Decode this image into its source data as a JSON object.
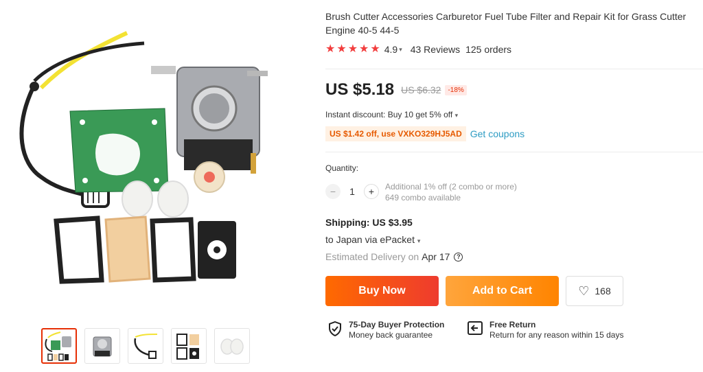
{
  "product": {
    "title": "Brush Cutter Accessories Carburetor Fuel Tube Filter and Repair Kit for Grass Cutter Engine 40-5 44-5",
    "rating": "4.9",
    "reviews": "43 Reviews",
    "orders": "125 orders"
  },
  "price": {
    "current": "US $5.18",
    "original": "US $6.32",
    "discount": "-18%"
  },
  "promo": {
    "instant": "Instant discount: Buy 10 get 5% off",
    "coupon": "US $1.42 off, use VXKO329HJ5AD",
    "get_coupons": "Get coupons"
  },
  "quantity": {
    "label": "Quantity:",
    "value": "1",
    "minus": "−",
    "plus": "+",
    "info1": "Additional 1% off (2 combo or more)",
    "info2": "649 combo available"
  },
  "shipping": {
    "cost": "Shipping: US $3.95",
    "to": "to Japan via ePacket",
    "delivery_label": "Estimated Delivery on",
    "delivery_date": "Apr 17",
    "help": "?"
  },
  "actions": {
    "buy_now": "Buy Now",
    "add_to_cart": "Add to Cart",
    "wishlist_count": "168"
  },
  "protection": {
    "buyer_title": "75-Day Buyer Protection",
    "buyer_sub": "Money back guarantee",
    "return_title": "Free Return",
    "return_sub": "Return for any reason within 15 days"
  },
  "colors": {
    "accent": "#e62e04",
    "star": "#f23d3d",
    "link": "#2e9cc3"
  }
}
